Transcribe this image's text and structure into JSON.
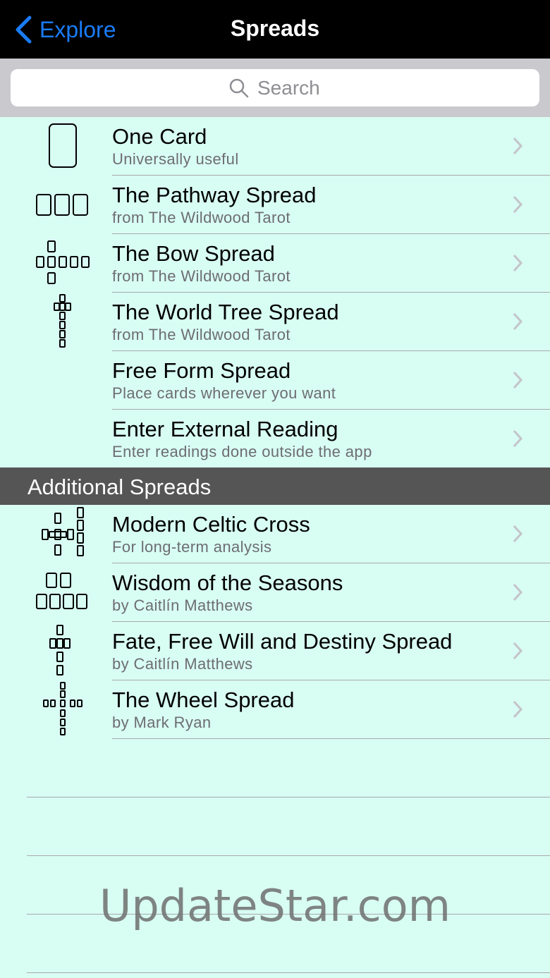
{
  "navbar": {
    "back_label": "Explore",
    "title": "Spreads",
    "accent_color": "#1a7cf7"
  },
  "search": {
    "placeholder": "Search",
    "icon": "search-icon"
  },
  "spreads": [
    {
      "title": "One Card",
      "subtitle": "Universally useful",
      "icon": "one-card-spread-icon"
    },
    {
      "title": "The Pathway Spread",
      "subtitle": "from The Wildwood Tarot",
      "icon": "pathway-spread-icon"
    },
    {
      "title": "The Bow Spread",
      "subtitle": "from The Wildwood Tarot",
      "icon": "bow-spread-icon"
    },
    {
      "title": "The World Tree Spread",
      "subtitle": "from The Wildwood Tarot",
      "icon": "world-tree-spread-icon"
    },
    {
      "title": "Free Form Spread",
      "subtitle": "Place cards wherever you want"
    },
    {
      "title": "Enter External Reading",
      "subtitle": "Enter readings done outside the app"
    }
  ],
  "section_header": "Additional Spreads",
  "additional_spreads": [
    {
      "title": "Modern Celtic Cross",
      "subtitle": "For long-term analysis",
      "icon": "celtic-cross-spread-icon"
    },
    {
      "title": "Wisdom of the Seasons",
      "subtitle": "by Caitlín Matthews",
      "icon": "seasons-spread-icon"
    },
    {
      "title": "Fate, Free Will and Destiny Spread",
      "subtitle": "by Caitlín Matthews",
      "icon": "fate-spread-icon"
    },
    {
      "title": "The Wheel Spread",
      "subtitle": "by Mark Ryan",
      "icon": "wheel-spread-icon"
    }
  ],
  "watermark": "UpdateStar.com",
  "colors": {
    "list_background": "#d8fdf2",
    "section_header": "#555555",
    "navbar": "#000000"
  }
}
